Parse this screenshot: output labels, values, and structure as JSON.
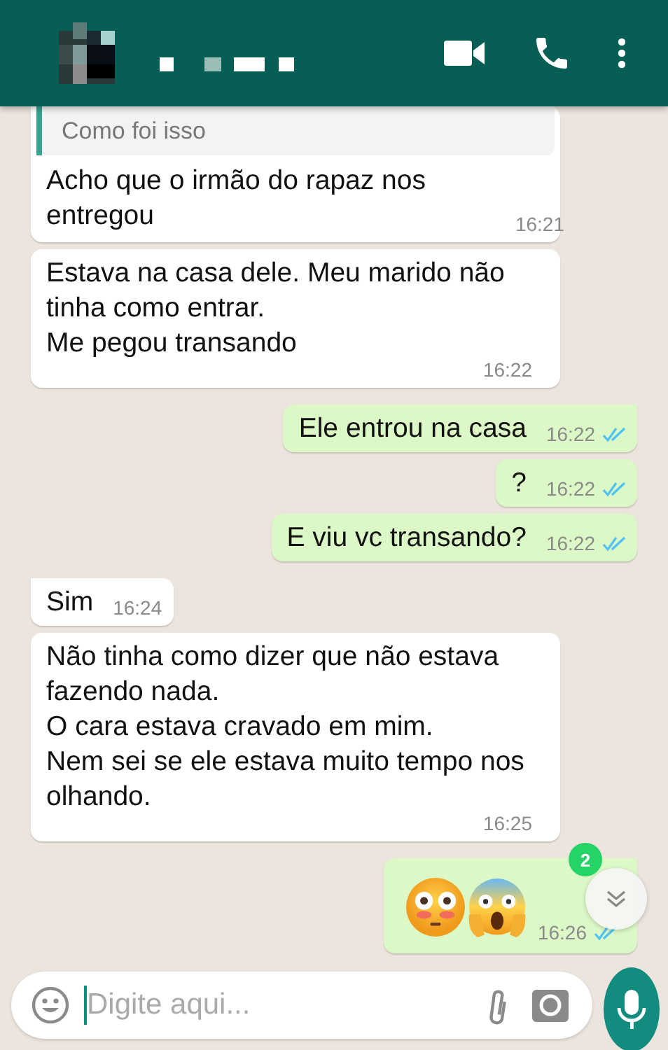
{
  "header": {
    "kind": "chat"
  },
  "messages": [
    {
      "outgoing": false,
      "kind": "text",
      "quote": "Como foi isso",
      "text": "Acho que o irmão do rapaz nos entregou",
      "time": "16:21"
    },
    {
      "outgoing": false,
      "kind": "text",
      "lines": [
        "Estava na casa dele.  Meu marido não tinha como entrar.",
        "Me pegou transando"
      ],
      "time": "16:22"
    },
    {
      "outgoing": true,
      "kind": "text",
      "text": "Ele entrou na casa",
      "time": "16:22",
      "read": true
    },
    {
      "outgoing": true,
      "kind": "text",
      "text": "?",
      "time": "16:22",
      "read": true
    },
    {
      "outgoing": true,
      "kind": "text",
      "text": "E viu vc transando?",
      "time": "16:22",
      "read": true
    },
    {
      "outgoing": false,
      "kind": "text",
      "text": "Sim",
      "time": "16:24"
    },
    {
      "outgoing": false,
      "kind": "text",
      "lines": [
        "Não tinha como dizer que não estava fazendo nada.",
        "O cara estava cravado em mim.",
        "Nem sei se ele estava muito tempo nos olhando."
      ],
      "time": "16:25"
    },
    {
      "outgoing": true,
      "kind": "emoji",
      "time": "16:26",
      "read": true
    }
  ],
  "scroll_badge": "2",
  "input": {
    "placeholder": "Digite aqui..."
  }
}
